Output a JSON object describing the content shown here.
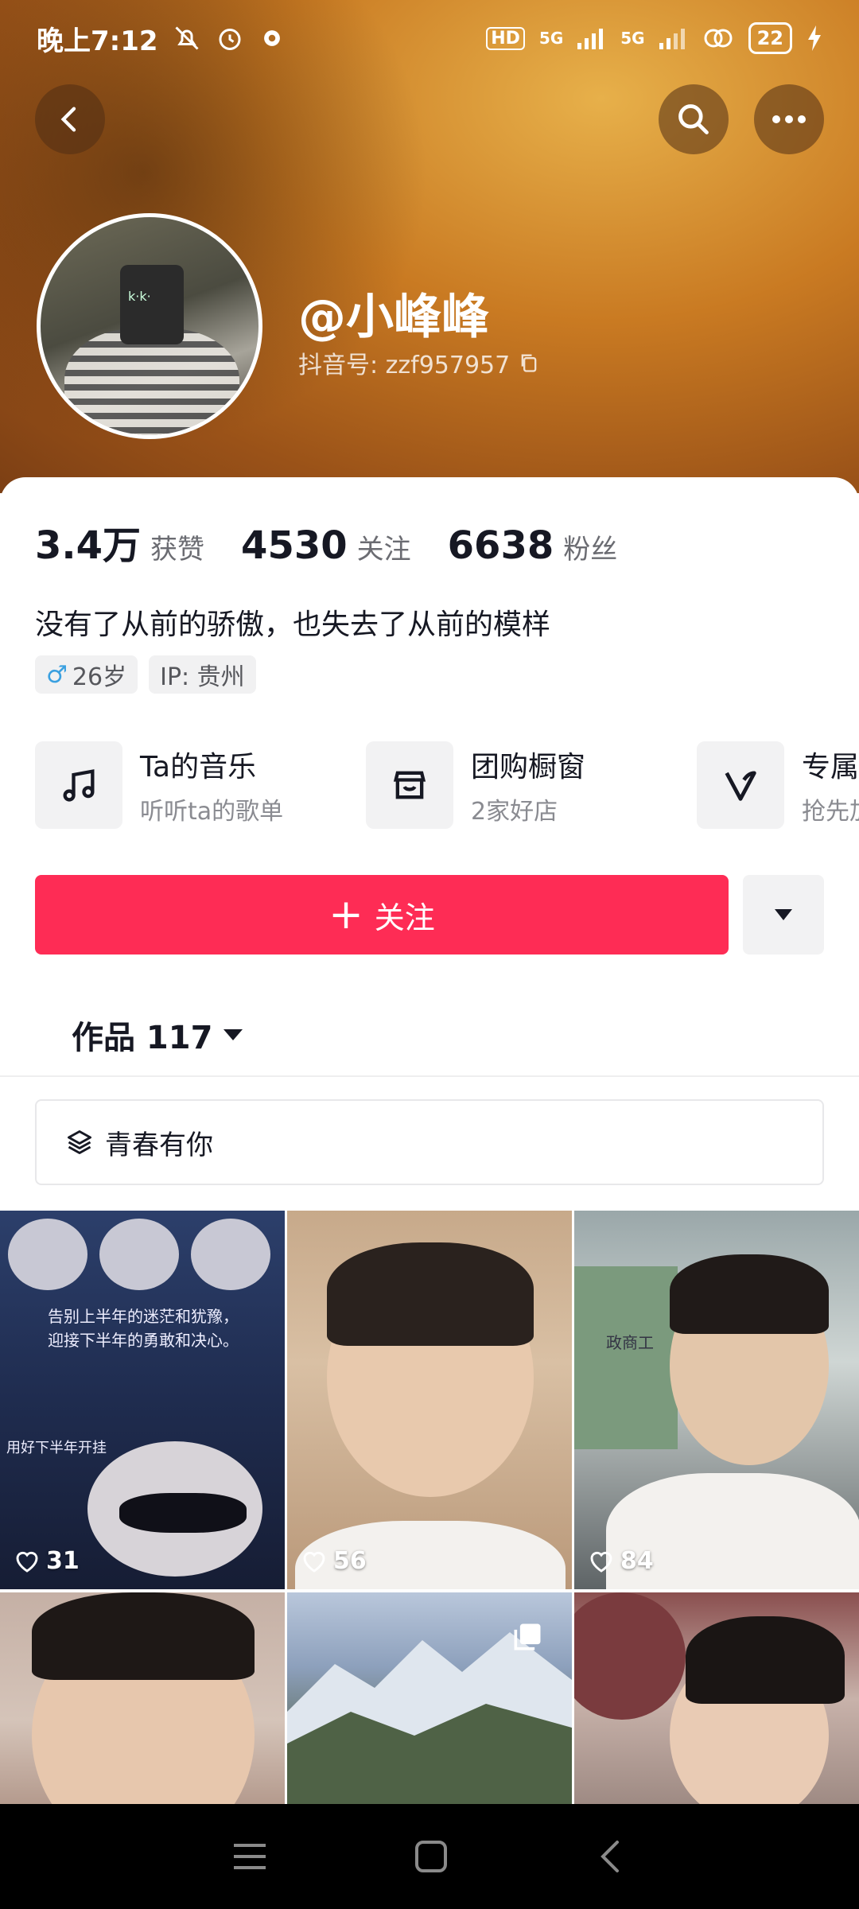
{
  "status_bar": {
    "time": "晚上7:12",
    "signal_1": "5G",
    "signal_2": "5G",
    "hd": "HD",
    "battery": "22"
  },
  "profile": {
    "username": "@小峰峰",
    "douyin_id": "抖音号: zzf957957",
    "avatar_phone_text": "k·k·"
  },
  "stats": [
    {
      "value": "3.4万",
      "label": "获赞"
    },
    {
      "value": "4530",
      "label": "关注"
    },
    {
      "value": "6638",
      "label": "粉丝"
    }
  ],
  "bio": "没有了从前的骄傲，也失去了从前的模样",
  "tags": {
    "gender_symbol": "♂",
    "age": "26岁",
    "ip": "IP: 贵州"
  },
  "features": [
    {
      "title": "Ta的音乐",
      "subtitle": "听听ta的歌单",
      "icon": "music-note-icon"
    },
    {
      "title": "团购橱窗",
      "subtitle": "2家好店",
      "icon": "shop-icon"
    },
    {
      "title": "专属会",
      "subtitle": "抢先加入",
      "icon": "v-badge-icon"
    }
  ],
  "actions": {
    "follow_label": "关注",
    "follow_plus": "+"
  },
  "works_tab": {
    "label": "作品 117"
  },
  "playlist": {
    "title": "青春有你"
  },
  "videos": [
    {
      "likes": "31",
      "caption_line1": "告别上半年的迷茫和犹豫，",
      "caption_line2": "迎接下半年的勇敢和决心。",
      "caption_line3": "用好下半年开挂"
    },
    {
      "likes": "56"
    },
    {
      "likes": "84",
      "sign": "政商工"
    },
    {
      "likes": ""
    },
    {
      "likes": ""
    },
    {
      "likes": ""
    }
  ],
  "colors": {
    "accent": "#fe2c55",
    "header_gradient": "#c97a22"
  }
}
